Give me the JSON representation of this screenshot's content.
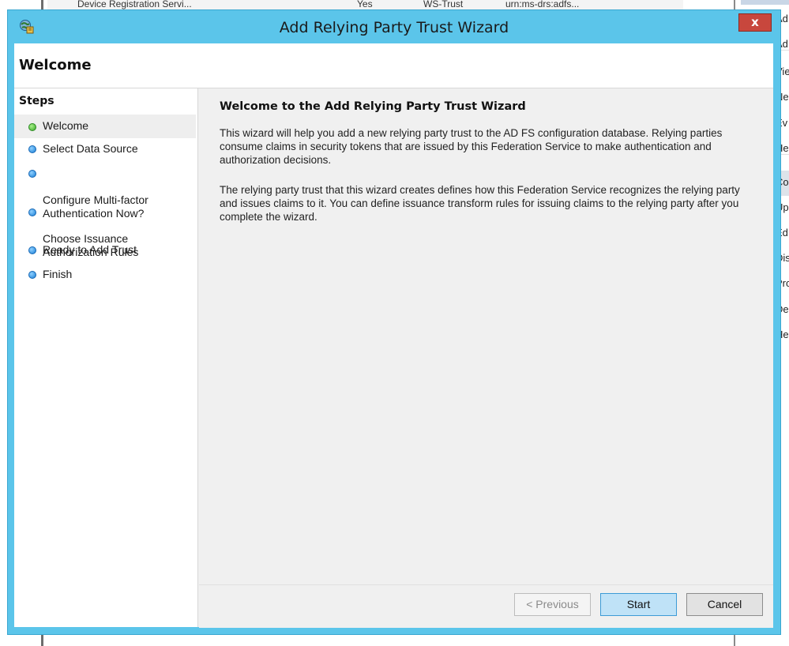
{
  "background": {
    "table_fragments": [
      "Device Registration Servi...",
      "Yes",
      "WS-Trust",
      "urn:ms-drs:adfs..."
    ],
    "actions_pane_fragments": [
      "Ad",
      "Ad",
      "Vie",
      "Ne",
      "Ev",
      "He",
      "Co",
      "Up",
      "Ed",
      "Dis",
      "Pro",
      "De",
      "He"
    ]
  },
  "window": {
    "title": "Add Relying Party Trust Wizard",
    "close_label": "x"
  },
  "header": {
    "page_heading": "Welcome"
  },
  "steps": {
    "title": "Steps",
    "items": [
      {
        "label": "Welcome",
        "status": "current"
      },
      {
        "label": "Select Data Source",
        "status": "pending"
      },
      {
        "label": "Configure Multi-factor\nAuthentication Now?",
        "status": "pending"
      },
      {
        "label": "Choose Issuance\nAuthorization Rules",
        "status": "pending"
      },
      {
        "label": "Ready to Add Trust",
        "status": "pending"
      },
      {
        "label": "Finish",
        "status": "pending"
      }
    ]
  },
  "content": {
    "heading": "Welcome to the Add Relying Party Trust Wizard",
    "paragraph_1": "This wizard will help you add a new relying party trust to the AD FS configuration database.  Relying parties consume claims in security tokens that are issued by this Federation Service to make authentication and authorization decisions.",
    "paragraph_2": "The relying party trust that this wizard creates defines how this Federation Service recognizes the relying party and issues claims to it. You can define issuance transform rules for issuing claims to the relying party after you complete the wizard."
  },
  "buttons": {
    "previous": "< Previous",
    "start": "Start",
    "cancel": "Cancel"
  },
  "colors": {
    "title_bar": "#5bc5ea",
    "close_button": "#c8473d",
    "current_step_dot": "#3aa82a",
    "pending_step_dot": "#1a7fd6",
    "default_button": "#bfe2f7"
  },
  "icons": {
    "window_icon": "adfs-wizard-icon",
    "close": "close-icon"
  }
}
